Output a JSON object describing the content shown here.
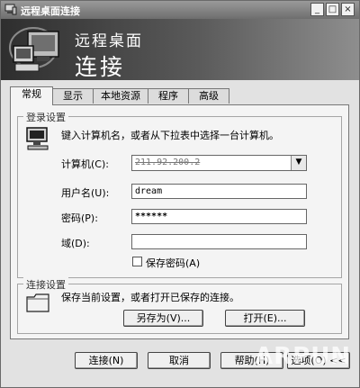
{
  "window": {
    "title": "远程桌面连接",
    "controls": {
      "minimize": "_",
      "maximize": "□",
      "close": "×"
    }
  },
  "banner": {
    "line1": "远程桌面",
    "line2": "连接"
  },
  "tabs": [
    {
      "label": "常规",
      "active": true
    },
    {
      "label": "显示"
    },
    {
      "label": "本地资源"
    },
    {
      "label": "程序"
    },
    {
      "label": "高级"
    }
  ],
  "login": {
    "group_title": "登录设置",
    "instruction": "键入计算机名，或者从下拉表中选择一台计算机。",
    "computer_label": "计算机(C):",
    "computer_value": "211.92.200.2",
    "username_label": "用户名(U):",
    "username_value": "dream",
    "password_label": "密码(P):",
    "password_value": "******",
    "domain_label": "域(D):",
    "domain_value": "",
    "save_password_label": "保存密码(A)",
    "save_password_checked": false
  },
  "connection": {
    "group_title": "连接设置",
    "description": "保存当前设置，或者打开已保存的连接。",
    "save_as": "另存为(V)...",
    "open": "打开(E)..."
  },
  "footer": {
    "connect": "连接(N)",
    "cancel": "取消",
    "help": "帮助(H)",
    "options": "选项(O) <<"
  },
  "watermark": "ARPUN"
}
